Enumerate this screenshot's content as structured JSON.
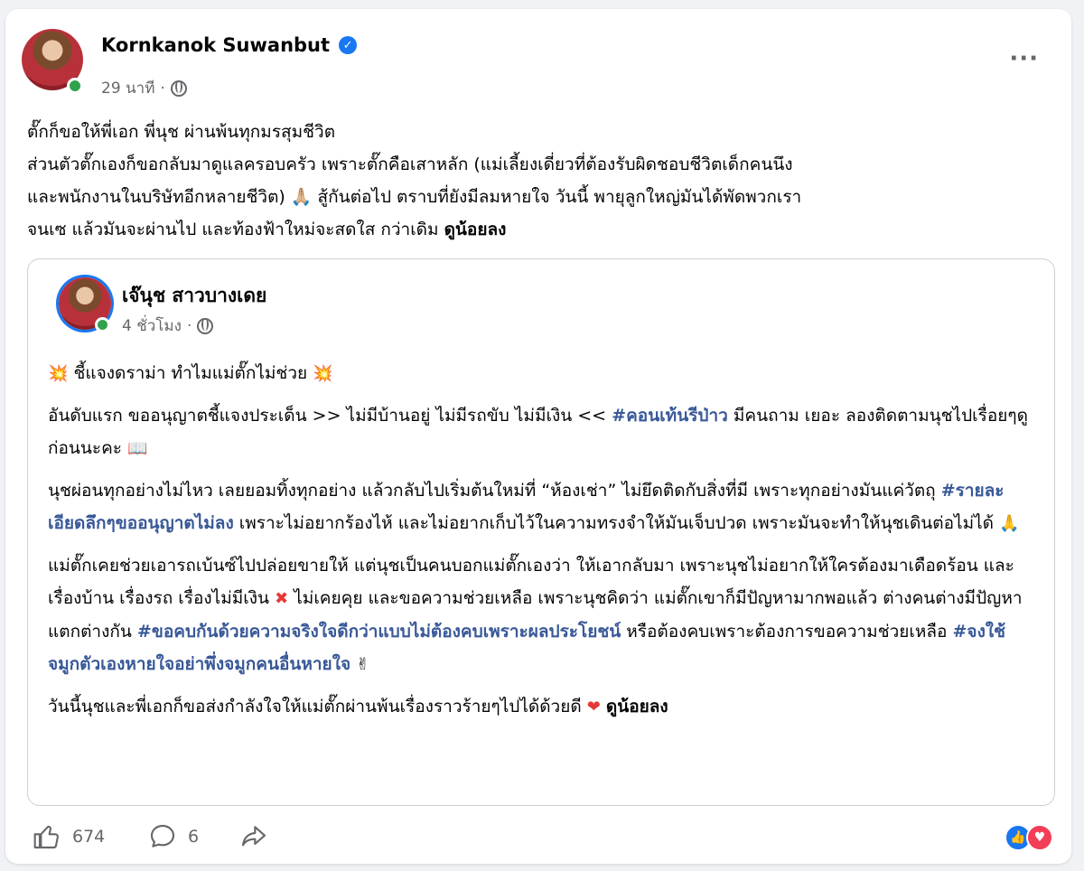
{
  "post": {
    "author": "Kornkanok Suwanbut",
    "time": "29 นาที",
    "lines": [
      "ตั๊กก็ขอให้พี่เอก พี่นุช ผ่านพ้นทุกมรสุมชีวิต",
      "ส่วนตัวตั๊กเองก็ขอกลับมาดูแลครอบครัว เพราะตั๊กคือเสาหลัก (แม่เลี้ยงเดี่ยวที่ต้องรับผิดชอบชีวิตเด็กคนนึง",
      "และพนักงานในบริษัทอีกหลายชีวิต) 🙏🏼 สู้กันต่อไป ตราบที่ยังมีลมหายใจ วันนี้ พายุลูกใหญ่มันได้พัดพวกเรา",
      "จนเซ แล้วมันจะผ่านไป และท้องฟ้าใหม่จะสดใส กว่าเดิม"
    ],
    "see_more": "ดูน้อยลง"
  },
  "shared": {
    "author": "เจ๊นุช สาวบางเดย",
    "time": "4 ชั่วโมง",
    "title": "ชี้แจงดราม่า ทำไมแม่ตั๊กไม่ช่วย",
    "p1_a": "อันดับแรก ขออนุญาตชี้แจงประเด็น >> ไม่มีบ้านอยู่  ไม่มีรถขับ  ไม่มีเงิน <<",
    "p1_tag": "#คอนเท้นรีป่าว",
    "p1_b": "มีคนถาม เยอะ  ลองติดตามนุชไปเรื่อยๆดูก่อนนะคะ",
    "p2_a": "นุชผ่อนทุกอย่างไม่ไหว เลยยอมทิ้งทุกอย่าง แล้วกลับไปเริ่มต้นใหม่ที่ “ห้องเช่า” ไม่ยึดติดกับสิ่งที่มี เพราะทุกอย่างมันแค่วัตถุ",
    "p2_tag": "#รายละเอียดลึกๆขออนุญาตไม่ลง",
    "p2_b": "เพราะไม่อยากร้องไห้ และไม่อยากเก็บไว้ในความทรงจำให้มันเจ็บปวด  เพราะมันจะทำให้นุชเดินต่อไม่ได้",
    "p3_a": "แม่ตั๊กเคยช่วยเอารถเบ้นซ์ไปปล่อยขายให้  แต่นุชเป็นคนบอกแม่ตั๊กเองว่า  ให้เอากลับมา เพราะนุชไม่อยากให้ใครต้องมาเดือดร้อน และเรื่องบ้าน เรื่องรถ เรื่องไม่มีเงิน",
    "p3_b": "ไม่เคยคุย และขอความช่วยเหลือ เพราะนุชคิดว่า  แม่ตั๊กเขาก็มีปัญหามากพอแล้ว  ต่างคนต่างมีปัญหาแตกต่างกัน",
    "p3_tag1": "#ขอคบกันด้วยความจริงใจดีกว่าแบบไม่ต้องคบเพราะผลประโยชน์",
    "p3_c": "หรือต้องคบเพราะต้องการขอความช่วยเหลือ",
    "p3_tag2": "#จงใช้จมูกตัวเองหายใจอย่าพึ่งจมูกคนอื่นหายใจ",
    "p4": "วันนี้นุชและพี่เอกก็ขอส่งกำลังใจให้แม่ตั๊กผ่านพ้นเรื่องราวร้ายๆไปได้ด้วยดี",
    "see_more": "ดูน้อยลง"
  },
  "footer": {
    "likes": "674",
    "comments": "6"
  },
  "icons": {
    "verified": "verified-badge-icon",
    "globe": "globe-icon",
    "more": "more-options-icon",
    "like": "like-icon",
    "comment": "comment-icon",
    "share": "share-icon",
    "reaction_like": "like-reaction-icon",
    "reaction_love": "love-reaction-icon"
  },
  "colors": {
    "hashtag": "#385898",
    "verified": "#1877f2",
    "online": "#31a24c",
    "secondary_text": "#65676b"
  }
}
